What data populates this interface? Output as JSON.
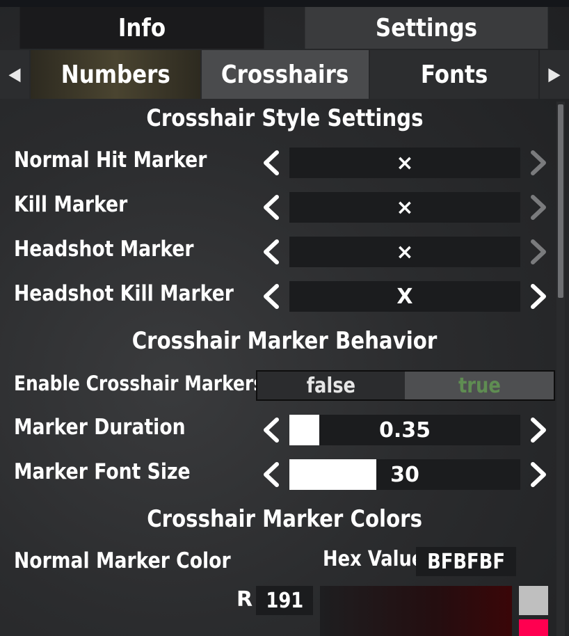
{
  "tabs_main": [
    {
      "label": "Info",
      "active": false
    },
    {
      "label": "Settings",
      "active": true
    }
  ],
  "tabs_sub": {
    "prev_arrow": "◀",
    "next_arrow": "▶",
    "items": [
      {
        "label": "Numbers"
      },
      {
        "label": "Crosshairs",
        "selected": true
      },
      {
        "label": "Fonts"
      }
    ]
  },
  "sections": {
    "style_title": "Crosshair Style Settings",
    "behavior_title": "Crosshair Marker Behavior",
    "colors_title": "Crosshair Marker Colors"
  },
  "style_rows": [
    {
      "label": "Normal Hit Marker",
      "value": "×",
      "next_enabled": false
    },
    {
      "label": "Kill Marker",
      "value": "×",
      "next_enabled": false
    },
    {
      "label": "Headshot Marker",
      "value": "×",
      "next_enabled": false
    },
    {
      "label": "Headshot Kill Marker",
      "value": "X",
      "next_enabled": true
    }
  ],
  "behavior": {
    "enable_label": "Enable Crosshair Markers",
    "toggle_false": "false",
    "toggle_true": "true",
    "toggle_selected": "true",
    "duration_label": "Marker Duration",
    "duration_value": "0.35",
    "duration_fraction": 0.13,
    "fontsize_label": "Marker Font Size",
    "fontsize_value": "30",
    "fontsize_fraction": 0.375
  },
  "colors": {
    "normal_label": "Normal Marker Color",
    "hex_label": "Hex Value",
    "hex_value": "BFBFBF",
    "r_label": "R",
    "r_value": "191",
    "swatch_current": "#bfbfbf",
    "swatch_accent": "#ff0050"
  },
  "theme": {
    "true_text_color": "#5f8d52",
    "disabled_chevron_color": "#7a7b7d"
  }
}
